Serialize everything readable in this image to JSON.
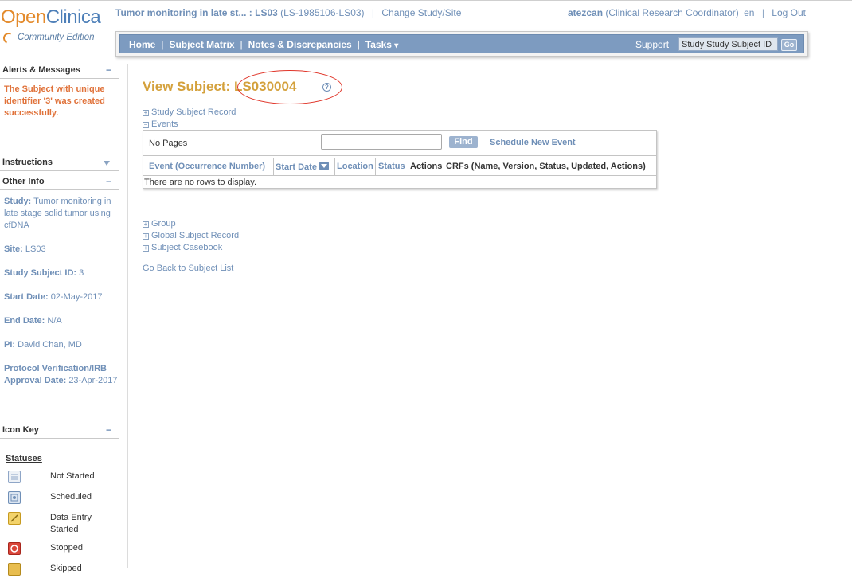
{
  "header": {
    "logo_open": "Open",
    "logo_clinica": "Clinica",
    "logo_edition": "Community Edition",
    "study_name": "Tumor monitoring in late st... : LS03",
    "study_code": "(LS-1985106-LS03)",
    "separator": "|",
    "change_study": "Change Study/Site",
    "user": "atezcan",
    "role": "(Clinical Research Coordinator)",
    "lang": "en",
    "logout": "Log Out"
  },
  "navbar": {
    "items": [
      "Home",
      "Subject Matrix",
      "Notes & Discrepancies",
      "Tasks"
    ],
    "separator": "|",
    "tasks_caret": "▾",
    "support": "Support",
    "search_value": "Study Study Subject ID",
    "go_label": "Go"
  },
  "sidebar": {
    "alerts": {
      "title": "Alerts & Messages",
      "toggle": "−",
      "message": "The Subject with unique identifier '3' was created successfully."
    },
    "instructions": {
      "title": "Instructions"
    },
    "other_info": {
      "title": "Other Info",
      "toggle": "−",
      "study_label": "Study:",
      "study_value": "Tumor monitoring in late stage solid tumor using cfDNA",
      "site_label": "Site:",
      "site_value": "LS03",
      "ssid_label": "Study Subject ID:",
      "ssid_value": "3",
      "start_label": "Start Date:",
      "start_value": "02-May-2017",
      "end_label": "End Date:",
      "end_value": "N/A",
      "pi_label": "PI:",
      "pi_value": "David Chan, MD",
      "pv_label": "Protocol Verification/IRB Approval Date:",
      "pv_value": "23-Apr-2017"
    },
    "icon_key": {
      "title": "Icon Key",
      "toggle": "−",
      "statuses_title": "Statuses",
      "statuses": [
        {
          "label": "Not Started",
          "icon": "not-started-icon",
          "color": "#8fa6c7"
        },
        {
          "label": "Scheduled",
          "icon": "scheduled-icon",
          "color": "#6f8fb7"
        },
        {
          "label": "Data Entry Started",
          "icon": "data-entry-started-icon",
          "color": "#e8b83a"
        },
        {
          "label": "Stopped",
          "icon": "stopped-icon",
          "color": "#d9463a"
        },
        {
          "label": "Skipped",
          "icon": "skipped-icon",
          "color": "#e0a832"
        }
      ]
    }
  },
  "main": {
    "title_prefix": "View Subject:",
    "subject_id": "LS030004",
    "help": "?",
    "toggle_symbol": "+",
    "toggle_open": "−",
    "study_subject_record": "Study Subject Record",
    "events": "Events",
    "events_table": {
      "no_pages": "No Pages",
      "find": "Find",
      "schedule_new_event": "Schedule New Event",
      "columns": [
        "Event (Occurrence Number)",
        "Start Date",
        "Location",
        "Status",
        "Actions",
        "CRFs (Name, Version, Status, Updated, Actions)"
      ],
      "empty_message": "There are no rows to display."
    },
    "group": "Group",
    "global_subject_record": "Global Subject Record",
    "subject_casebook": "Subject Casebook",
    "back_link": "Go Back to Subject List"
  },
  "colors": {
    "accent_orange": "#e38a2b",
    "link_blue": "#6f8fb7",
    "nav_blue": "#7d9bc0",
    "title_gold": "#d4a13c",
    "alert_orange": "#e0723a",
    "annotation_red": "#e0362a"
  }
}
